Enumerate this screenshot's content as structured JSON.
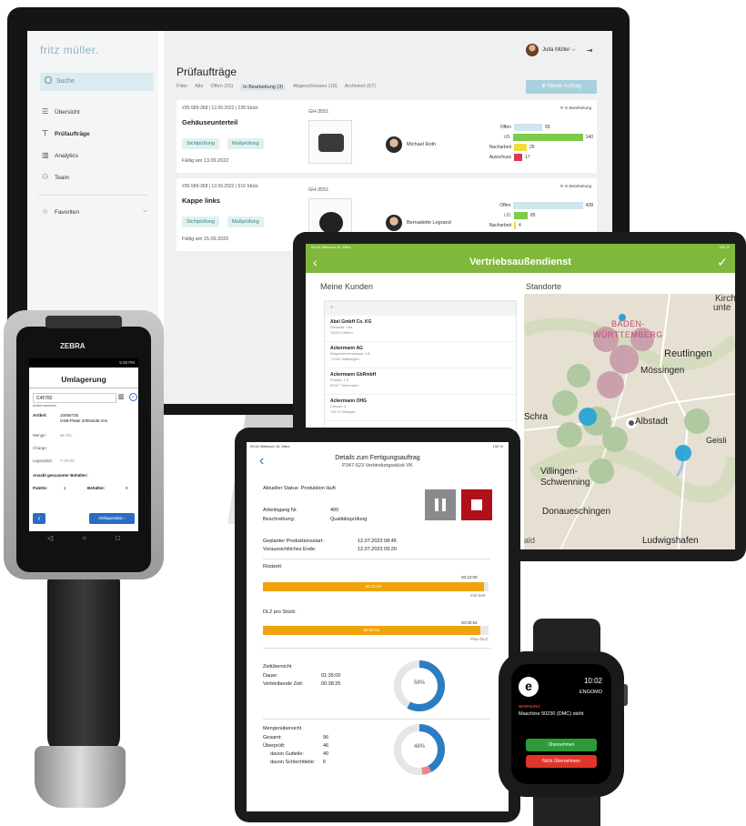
{
  "desktop": {
    "logo": "fritz müller.",
    "search_label": "Suche",
    "nav": [
      {
        "icon": "list-icon",
        "glyph": "☰",
        "label": "Übersicht"
      },
      {
        "icon": "inspect-icon",
        "glyph": "⊤",
        "label": "Prüfaufträge"
      },
      {
        "icon": "analytics-icon",
        "glyph": "▥",
        "label": "Analytics"
      },
      {
        "icon": "team-icon",
        "glyph": "⚇",
        "label": "Team"
      }
    ],
    "favorites_label": "Favoriten",
    "user_name": "Julia Müller ⌵",
    "page_title": "Prüfaufträge",
    "filter_label": "Filter",
    "filters": [
      "Alle",
      "Offen (15)",
      "In Bearbeitung (3)",
      "Abgeschlossen (18)",
      "Archiviert (67)"
    ],
    "new_button": "Neuer Auftrag",
    "cards": [
      {
        "meta": "#35-589-368 | 12.09.2022 | 238 Stück",
        "name": "Gehäuseunterteil",
        "tags": [
          "Sichtprüfung",
          "Maßprüfung"
        ],
        "due": "Fällig am 13.09.2022",
        "gh": "GH-3551",
        "person": "Michael Roth",
        "status": "In Bearbeitung",
        "bars": [
          {
            "label": "Offen",
            "value": 55,
            "max": 140,
            "color": "#cfe6ee"
          },
          {
            "label": "i.O.",
            "value": 140,
            "max": 140,
            "color": "#7ccb4a"
          },
          {
            "label": "Nacharbeit",
            "value": 26,
            "max": 140,
            "color": "#f2dd3c"
          },
          {
            "label": "Ausschuss",
            "value": 17,
            "max": 140,
            "color": "#d9384f"
          }
        ]
      },
      {
        "meta": "#35-589-368 | 12.09.2022 | 516 Stück",
        "name": "Kappe links",
        "tags": [
          "Sichtprüfung",
          "Maßprüfung"
        ],
        "due": "Fällig am 15.09.2022",
        "gh": "GH-3551",
        "person": "Bernadette Legrand",
        "status": "In Bearbeitung",
        "bars": [
          {
            "label": "Offen",
            "value": 428,
            "max": 428,
            "color": "#cfe6ee"
          },
          {
            "label": "i.O.",
            "value": 85,
            "max": 428,
            "color": "#7ccb4a"
          },
          {
            "label": "Nacharbeit",
            "value": 4,
            "max": 428,
            "color": "#f2dd3c"
          }
        ]
      }
    ]
  },
  "tablet": {
    "status_left": "09:41  Mittwoch 16. März",
    "status_right": "100 %",
    "title": "Vertriebsaußendienst",
    "customers_heading": "Meine Kunden",
    "locations_heading": "Standorte",
    "customers": [
      {
        "name": "Abel GmbH Co. KG",
        "l1": "Dieselstr. 18a",
        "l2": "76210 Keltern"
      },
      {
        "name": "Ackermann AG",
        "l1": "Bürgelsteinerstrasse 4-8",
        "l2": "71334 Waiblingen"
      },
      {
        "name": "Ackermann GbRmbH",
        "l1": "Poststr. 1 b",
        "l2": "83317 Teisendorf"
      },
      {
        "name": "Ackermann OHG",
        "l1": "Leitzstr. 3",
        "l2": "70173 Stuttgart"
      }
    ],
    "map_labels": [
      {
        "text": "Kirch",
        "cls": "big"
      },
      {
        "text": "unte",
        "cls": "big"
      },
      {
        "text": "BADEN-",
        "cls": "region"
      },
      {
        "text": "WÜRTTEMBERG",
        "cls": "region"
      },
      {
        "text": "Reutlingen",
        "cls": "big"
      },
      {
        "text": "Mössingen",
        "cls": "big"
      },
      {
        "text": "Albstadt",
        "cls": "big"
      },
      {
        "text": "Schra",
        "cls": "big"
      },
      {
        "text": "Villingen-",
        "cls": "big"
      },
      {
        "text": "Schwenning",
        "cls": "big"
      },
      {
        "text": "Geisli",
        "cls": "big"
      },
      {
        "text": "Donaueschingen",
        "cls": "big"
      },
      {
        "text": "Ludwigshafen",
        "cls": "big"
      },
      {
        "text": "ald",
        "cls": "big"
      }
    ]
  },
  "scanner": {
    "brand": "ZEBRA",
    "time": "5:28 PM",
    "title": "Umlagerung",
    "scan_value": "C45782",
    "scan_hint": "Artikel scannen",
    "article_label": "Artikel:",
    "article_value": "10056735",
    "article_desc": "OSB-Platte 2000x535 mm",
    "qty_label": "Menge:",
    "qty_value": "66 Stk.",
    "charge_label": "Charge:",
    "lager_label": "Lagerplatz:",
    "lager_value": "F-03-08",
    "count_heading": "Anzahl gescannter Behälter:",
    "palette_label": "Palette:",
    "palette_value": "1",
    "behaelter_label": "Behälter:",
    "behaelter_value": "0",
    "target_button": "Ziellagerplatz"
  },
  "production": {
    "status_left": "09:41  Mittwoch 16. März",
    "status_right": "100 %",
    "title": "Details zum Fertigungsauftrag",
    "subtitle": "P347-523 Verbindungsstück VK",
    "current_status": "Aktueller Status: Produktion läuft",
    "step_label": "Arbeitsgang Nr.",
    "step_value": "400",
    "desc_label": "Beschreibung:",
    "desc_value": "Qualitätsprüfung",
    "planned_start_label": "Geplanter Produktionsstart:",
    "planned_start_value": "12.07.2023 08:45",
    "expected_end_label": "Voraussichtliches Ende:",
    "expected_end_value": "12.07.2023 09:20",
    "ruestzeit_label": "Rüstzeit:",
    "ruestzeit_target": "00:12:00",
    "ruestzeit_value": "00:11:44",
    "ruestzeit_fraction": 0.978,
    "ruestzeit_caption": "Ziel-Zeit",
    "dlz_label": "DLZ pro Stück:",
    "dlz_target": "00:00:54",
    "dlz_value": "00:00:52",
    "dlz_fraction": 0.963,
    "dlz_caption": "Plan-DLZ",
    "time_heading": "Zeitübersicht",
    "dauer_label": "Dauer:",
    "dauer_value": "01:35:00",
    "remain_label": "Verbleibende Zeit:",
    "remain_value": "00:38:25",
    "donut1_label": "58%",
    "donut1_value": 58,
    "qty_heading": "Mengenübersicht",
    "gesamt_label": "Gesamt:",
    "gesamt_value": "96",
    "geprueft_label": "Überprüft:",
    "geprueft_value": "46",
    "gut_label": "davon Gutteile:",
    "gut_value": "40",
    "schlecht_label": "davon Schlechtteile:",
    "schlecht_value": "6",
    "donut2_label": "48%",
    "donut2_value": 48,
    "donut2_bad": 6
  },
  "watch": {
    "time": "10:02",
    "app": "ENGOMO",
    "logo": "e",
    "warning": "WARNUNG",
    "message": "Maschine 50230 (DMC) steht",
    "accept": "Übernehmen",
    "decline": "Nicht Übernehmen"
  },
  "colors": {
    "green": "#7fb83a",
    "accent_blue": "#2b7dc4",
    "orange": "#f0a30a",
    "stop_red": "#b0101a",
    "watch_green": "#2e9a3a",
    "watch_red": "#e0352b"
  }
}
